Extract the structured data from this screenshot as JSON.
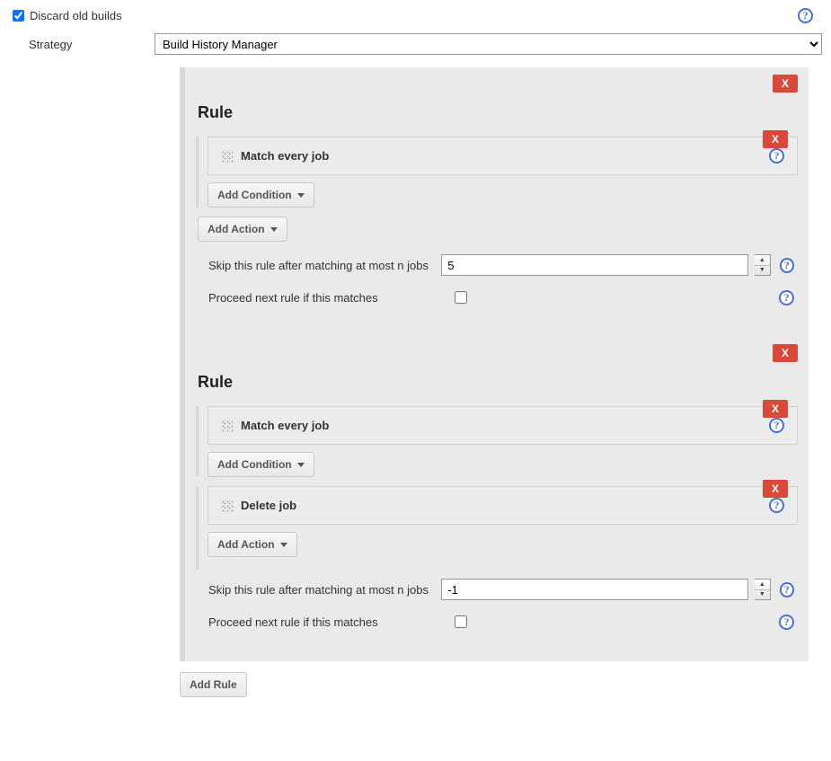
{
  "top": {
    "discard_label": "Discard old builds",
    "discard_checked": true
  },
  "strategy": {
    "label": "Strategy",
    "selected": "Build History Manager"
  },
  "buttons": {
    "add_condition": "Add Condition",
    "add_action": "Add Action",
    "add_rule": "Add Rule",
    "close_x": "X"
  },
  "labels": {
    "rule_heading": "Rule",
    "skip_label": "Skip this rule after matching at most n jobs",
    "proceed_label": "Proceed next rule if this matches"
  },
  "rules": [
    {
      "conditions": [
        {
          "label": "Match every job"
        }
      ],
      "actions": [],
      "skip_value": "5",
      "proceed_checked": false
    },
    {
      "conditions": [
        {
          "label": "Match every job"
        }
      ],
      "actions": [
        {
          "label": "Delete job"
        }
      ],
      "skip_value": "-1",
      "proceed_checked": false
    }
  ]
}
